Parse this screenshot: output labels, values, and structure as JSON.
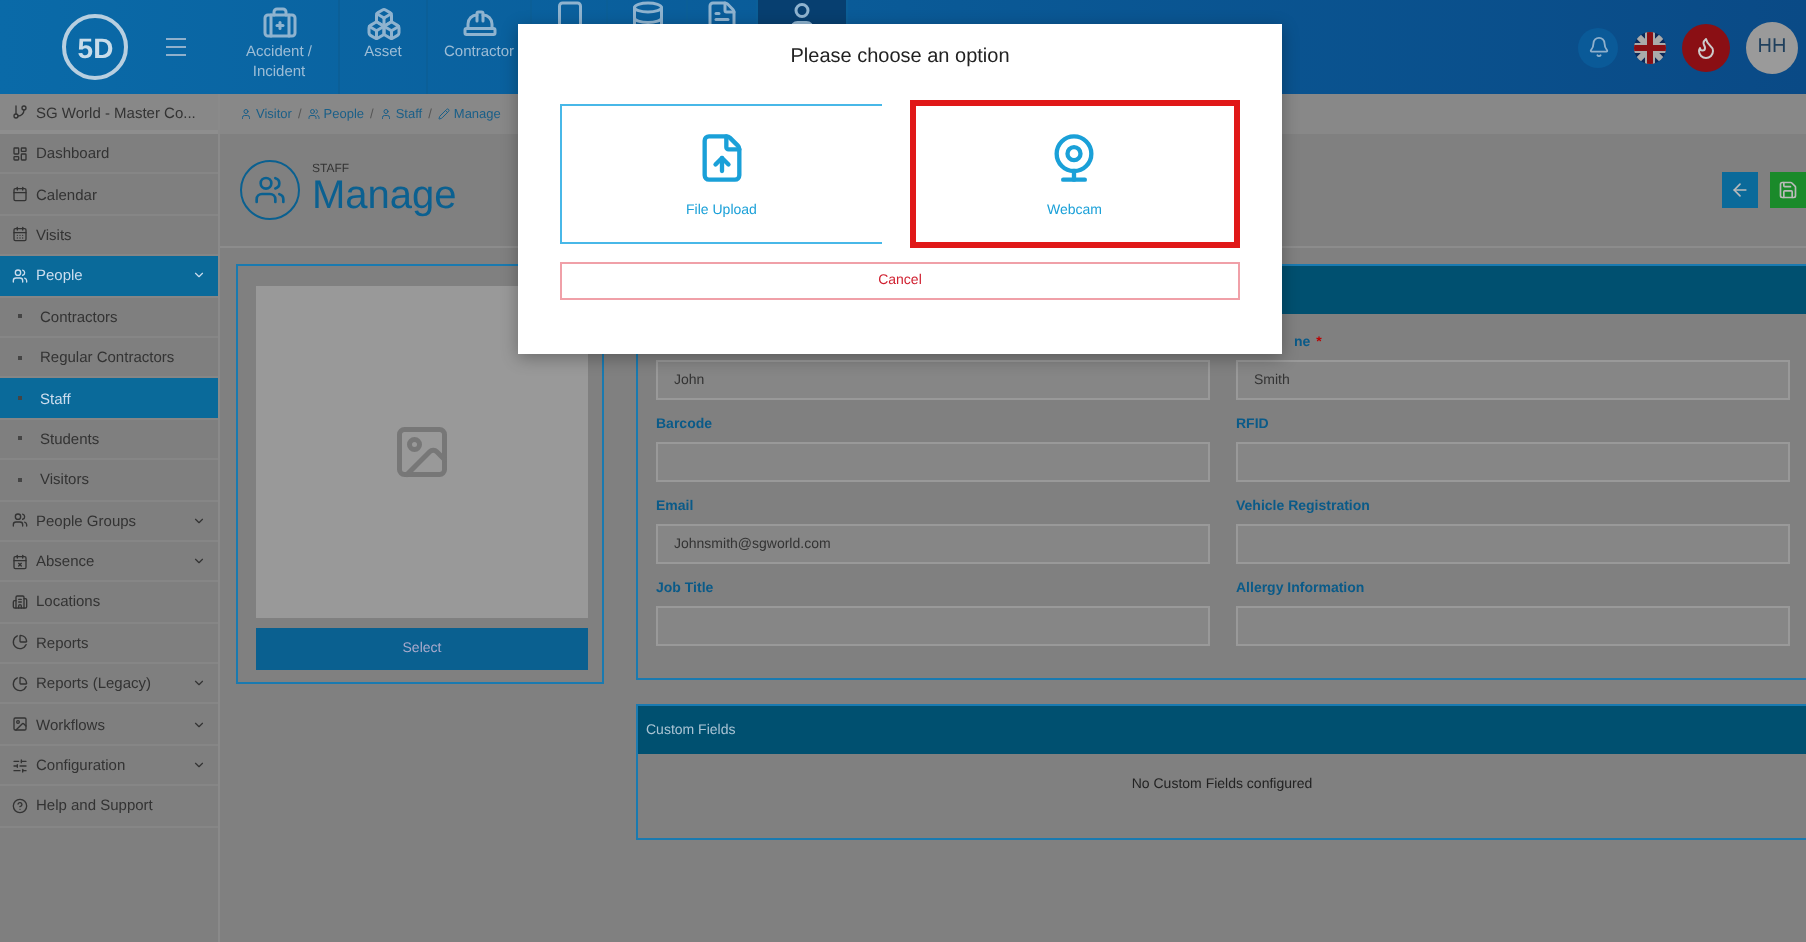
{
  "header": {
    "logo": "5D",
    "modules": [
      {
        "label": "Accident / Incident",
        "selected": false
      },
      {
        "label": "Asset",
        "selected": false
      },
      {
        "label": "Contractor",
        "selected": false
      },
      {
        "selected": false
      },
      {
        "selected": false
      },
      {
        "selected": false
      },
      {
        "selected": true
      }
    ],
    "avatar": "HH"
  },
  "sidebar": {
    "site": "SG World - Master Co...",
    "items": [
      {
        "label": "Dashboard",
        "kind": "link",
        "selected": false
      },
      {
        "label": "Calendar",
        "kind": "link",
        "selected": false
      },
      {
        "label": "Visits",
        "kind": "link",
        "selected": false
      },
      {
        "label": "People",
        "kind": "group",
        "selected": true,
        "children": [
          {
            "label": "Contractors",
            "selected": false
          },
          {
            "label": "Regular Contractors",
            "selected": false
          },
          {
            "label": "Staff",
            "selected": true
          },
          {
            "label": "Students",
            "selected": false
          },
          {
            "label": "Visitors",
            "selected": false
          }
        ]
      },
      {
        "label": "People Groups",
        "kind": "group",
        "selected": false
      },
      {
        "label": "Absence",
        "kind": "group",
        "selected": false
      },
      {
        "label": "Locations",
        "kind": "link",
        "selected": false
      },
      {
        "label": "Reports",
        "kind": "link",
        "selected": false
      },
      {
        "label": "Reports (Legacy)",
        "kind": "group",
        "selected": false
      },
      {
        "label": "Workflows",
        "kind": "group",
        "selected": false
      },
      {
        "label": "Configuration",
        "kind": "group",
        "selected": false
      },
      {
        "label": "Help and Support",
        "kind": "link",
        "selected": false
      }
    ]
  },
  "breadcrumb": {
    "separator": "/",
    "items": [
      "Visitor",
      "People",
      "Staff",
      "Manage"
    ]
  },
  "page": {
    "kicker": "STAFF",
    "title": "Manage"
  },
  "photo": {
    "button": "Select"
  },
  "form": {
    "fields": [
      {
        "value": "John"
      },
      {
        "label": "ne",
        "required_mark": "*",
        "cut": true,
        "value": "Smith"
      },
      {
        "label": "Barcode"
      },
      {
        "label": "RFID"
      },
      {
        "label": "Email",
        "value": "Johnsmith@sgworld.com"
      },
      {
        "label": "Vehicle Registration"
      },
      {
        "label": "Job Title"
      },
      {
        "label": "Allergy Information"
      }
    ]
  },
  "custom_fields": {
    "title": "Custom Fields",
    "empty": "No Custom Fields configured"
  },
  "dialog": {
    "title": "Please choose an option",
    "options": [
      {
        "label": "File Upload",
        "kind": "upload",
        "selected": false
      },
      {
        "label": "Webcam",
        "kind": "webcam",
        "selected": true
      }
    ],
    "cancel": "Cancel"
  }
}
